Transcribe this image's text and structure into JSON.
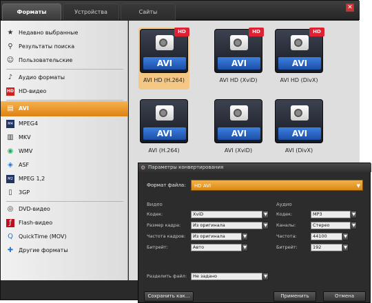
{
  "tabs": [
    {
      "label": "Форматы",
      "active": true
    },
    {
      "label": "Устройства",
      "active": false
    },
    {
      "label": "Сайты",
      "active": false
    }
  ],
  "sidebar": {
    "items": [
      {
        "label": "Недавно выбранные",
        "icon": "star-icon"
      },
      {
        "label": "Результаты поиска",
        "icon": "search-icon"
      },
      {
        "label": "Пользовательские",
        "icon": "user-icon"
      },
      {
        "label": "Аудио форматы",
        "icon": "music-note-icon"
      },
      {
        "label": "HD-видео",
        "icon": "hd-icon"
      },
      {
        "label": "AVI",
        "icon": "film-icon",
        "selected": true
      },
      {
        "label": "MPEG4",
        "icon": "mpeg-icon"
      },
      {
        "label": "MKV",
        "icon": "mkv-icon"
      },
      {
        "label": "WMV",
        "icon": "wmv-icon"
      },
      {
        "label": "ASF",
        "icon": "asf-icon"
      },
      {
        "label": "MPEG 1,2",
        "icon": "mpeg-icon"
      },
      {
        "label": "3GP",
        "icon": "phone-icon"
      },
      {
        "label": "DVD-видео",
        "icon": "disc-icon"
      },
      {
        "label": "Flash-видео",
        "icon": "flash-icon"
      },
      {
        "label": "QuickTime (MOV)",
        "icon": "quicktime-icon"
      },
      {
        "label": "Другие форматы",
        "icon": "more-icon"
      }
    ]
  },
  "grid": {
    "tiles": [
      {
        "format": "AVI",
        "badge": "HD",
        "caption": "AVI HD (H.264)",
        "selected": true
      },
      {
        "format": "AVI",
        "badge": "HD",
        "caption": "AVI HD (XviD)",
        "selected": false
      },
      {
        "format": "AVI",
        "badge": "HD",
        "caption": "AVI HD (DivX)",
        "selected": false
      },
      {
        "format": "AVI",
        "badge": "",
        "caption": "AVI (H.264)",
        "selected": false
      },
      {
        "format": "AVI",
        "badge": "",
        "caption": "AVI (XviD)",
        "selected": false
      },
      {
        "format": "AVI",
        "badge": "",
        "caption": "AVI (DivX)",
        "selected": false
      }
    ]
  },
  "dialog": {
    "title": "Параметры конвертирования",
    "format_label": "Формат файла:",
    "format_value": "HD AVI",
    "video_header": "Видео",
    "audio_header": "Аудио",
    "video_fields": [
      {
        "label": "Кодек:",
        "value": "XviD"
      },
      {
        "label": "Размер кадра:",
        "value": "Из оригинала"
      },
      {
        "label": "Частота кадров:",
        "value": "Из оригинала"
      },
      {
        "label": "Битрейт:",
        "value": "Авто"
      }
    ],
    "audio_fields": [
      {
        "label": "Кодек:",
        "value": "MP3"
      },
      {
        "label": "Каналы:",
        "value": "Стерео"
      },
      {
        "label": "Частота:",
        "value": "44100"
      },
      {
        "label": "Битрейт:",
        "value": "192"
      }
    ],
    "split_label": "Разделить файл:",
    "split_value": "Не задано",
    "buttons": {
      "save": "Сохранить как...",
      "apply": "Применить",
      "cancel": "Отмена"
    }
  },
  "colors": {
    "accent": "#de8212",
    "format_blue": "#1b4fa6",
    "hd_red": "#d22233",
    "dark_bg": "#2a2a2a"
  }
}
